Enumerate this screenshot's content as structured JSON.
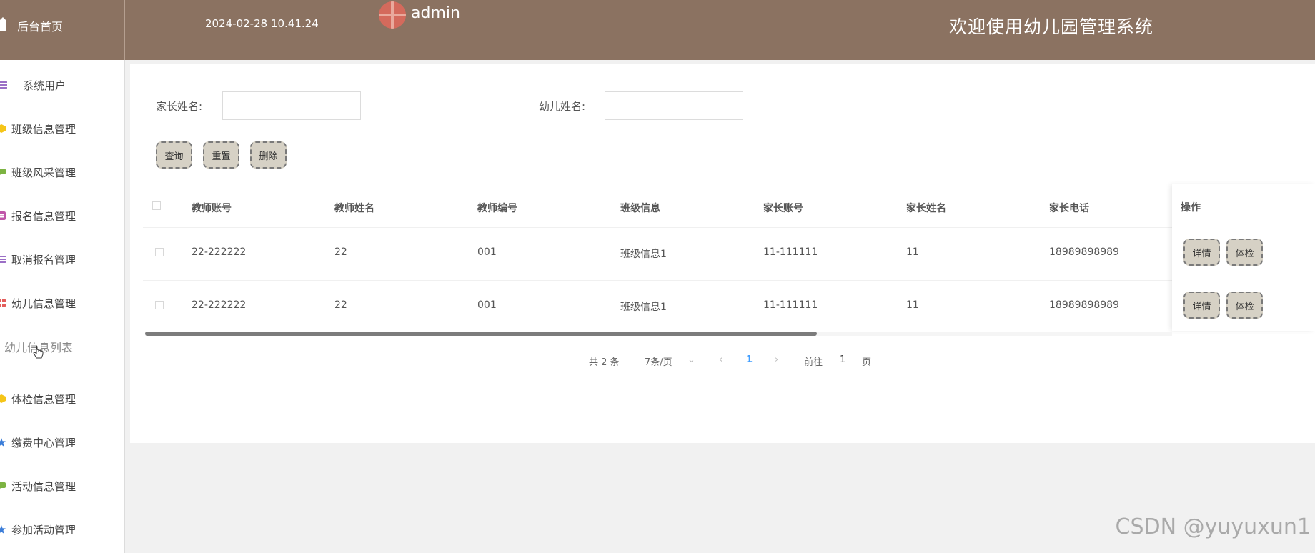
{
  "header": {
    "home_label": "后台首页",
    "datetime": "2024-02-28 10.41.24",
    "username": "admin",
    "system_title": "欢迎使用幼儿园管理系统",
    "bg_color": "#8b7261"
  },
  "sidebar": {
    "items": [
      {
        "label": "系统用户",
        "icon": "list-icon",
        "color": "#9b6fc6"
      },
      {
        "label": "班级信息管理",
        "icon": "hexagon-icon",
        "color": "#f5c518"
      },
      {
        "label": "班级风采管理",
        "icon": "chat-icon",
        "color": "#7cb342"
      },
      {
        "label": "报名信息管理",
        "icon": "form-icon",
        "color": "#c056a9"
      },
      {
        "label": "取消报名管理",
        "icon": "list-icon",
        "color": "#9b6fc6"
      },
      {
        "label": "幼儿信息管理",
        "icon": "grid-icon",
        "color": "#e35d5b"
      },
      {
        "label": "幼儿信息列表",
        "icon": "",
        "color": ""
      },
      {
        "label": "体检信息管理",
        "icon": "hexagon-icon",
        "color": "#f5c518"
      },
      {
        "label": "缴费中心管理",
        "icon": "star-icon",
        "color": "#3b7dd8"
      },
      {
        "label": "活动信息管理",
        "icon": "chat-icon",
        "color": "#7cb342"
      },
      {
        "label": "参加活动管理",
        "icon": "star-icon",
        "color": "#3b7dd8"
      }
    ]
  },
  "search": {
    "parent_name_label": "家长姓名:",
    "parent_name_value": "",
    "child_name_label": "幼儿姓名:",
    "child_name_value": ""
  },
  "actions": {
    "query": "查询",
    "reset": "重置",
    "delete": "删除"
  },
  "table": {
    "headers": [
      "教师账号",
      "教师姓名",
      "教师编号",
      "班级信息",
      "家长账号",
      "家长姓名",
      "家长电话"
    ],
    "ops_header": "操作",
    "rows": [
      [
        "22-222222",
        "22",
        "001",
        "班级信息1",
        "11-111111",
        "11",
        "18989898989"
      ],
      [
        "22-222222",
        "22",
        "001",
        "班级信息1",
        "11-111111",
        "11",
        "18989898989"
      ]
    ],
    "row_buttons": {
      "detail": "详情",
      "checkup": "体检"
    }
  },
  "pagination": {
    "total": "共 2 条",
    "page_size": "7条/页",
    "current_page": "1",
    "goto_label": "前往",
    "goto_value": "1",
    "page_suffix": "页"
  },
  "watermark": "CSDN @yuyuxun1"
}
